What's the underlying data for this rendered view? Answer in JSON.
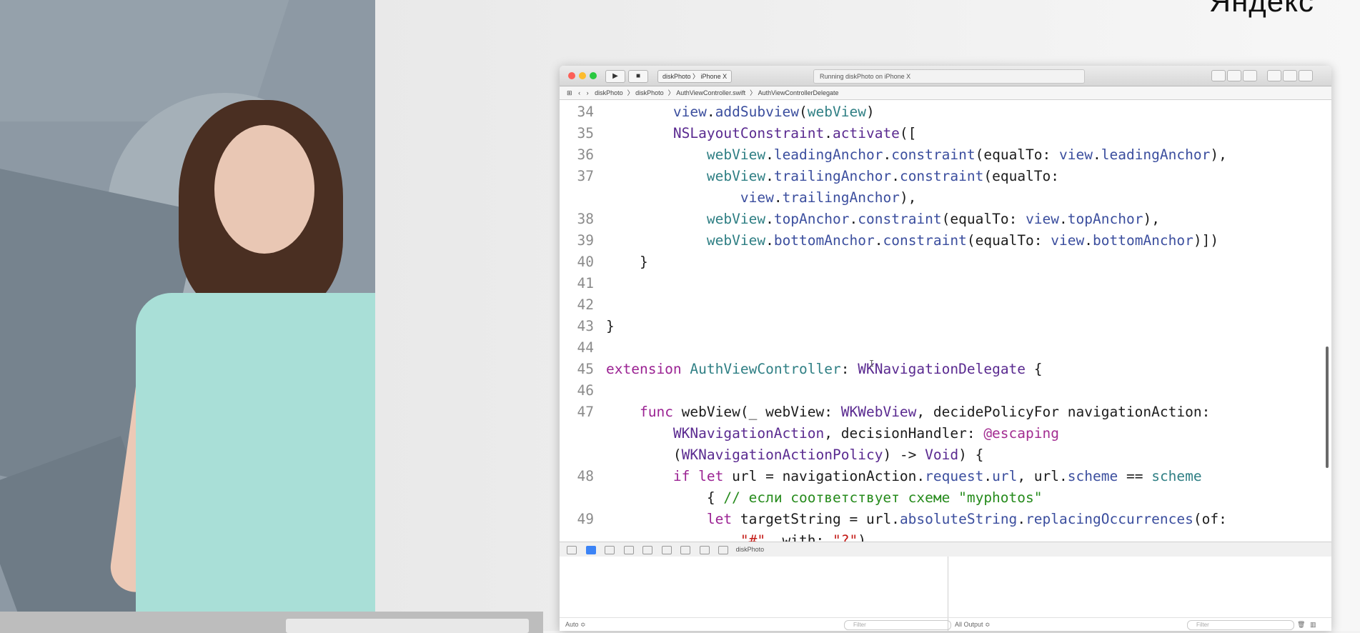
{
  "brand": "Яндекс",
  "window": {
    "scheme_project": "diskPhoto",
    "scheme_device": "iPhone X",
    "status": "Running diskPhoto on iPhone X"
  },
  "jumpbar": [
    "diskPhoto",
    "diskPhoto",
    "AuthViewController.swift",
    "AuthViewControllerDelegate"
  ],
  "code": {
    "line_numbers": [
      "34",
      "35",
      "36",
      "37",
      "38",
      "39",
      "40",
      "41",
      "42",
      "43",
      "44",
      "45",
      "46",
      "47",
      "48",
      "49"
    ]
  },
  "debug": {
    "target": "diskPhoto",
    "auto_label": "Auto ≎",
    "filter_placeholder": "Filter",
    "output_selector": "All Output ≎"
  }
}
